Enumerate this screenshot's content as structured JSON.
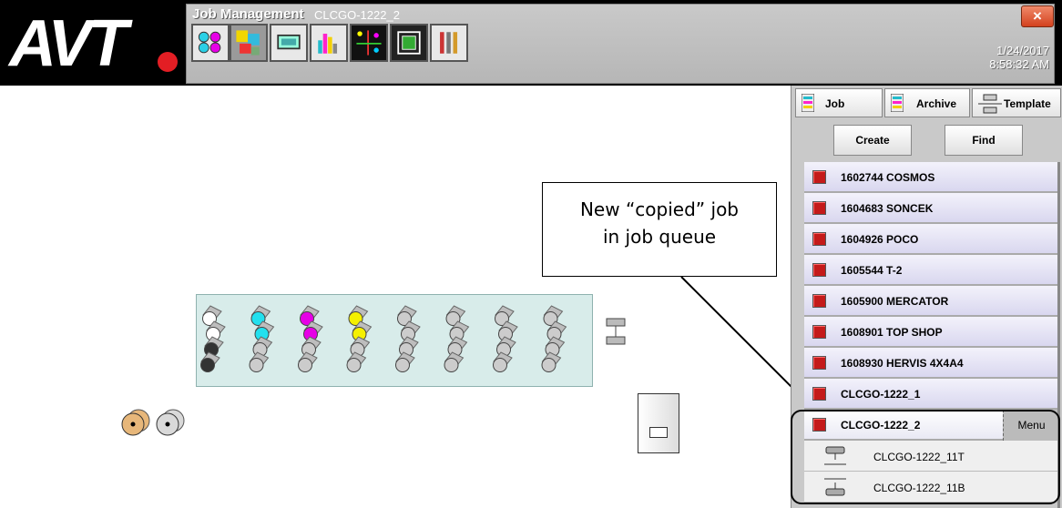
{
  "header": {
    "logo_text": "AVT",
    "app_title": "Job Management",
    "job_name": "CLCGO-1222_2",
    "date": "1/24/2017",
    "time": "8:58:32 AM",
    "close_label": "×",
    "toolbar": [
      "color-circles-icon",
      "job-management-icon",
      "monitor-icon",
      "bar-chart-icon",
      "registration-icon",
      "frame-icon",
      "tools-icon"
    ]
  },
  "panel": {
    "tabs": [
      {
        "label": "Job",
        "icon": "job-icon"
      },
      {
        "label": "Archive",
        "icon": "archive-icon"
      },
      {
        "label": "Template",
        "icon": "template-icon"
      }
    ],
    "create_label": "Create",
    "find_label": "Find",
    "jobs": [
      {
        "name": "1602744 COSMOS"
      },
      {
        "name": "1604683 SONCEK"
      },
      {
        "name": "1604926 POCO"
      },
      {
        "name": "1605544 T-2"
      },
      {
        "name": "1605900 MERCATOR"
      },
      {
        "name": "1608901 TOP SHOP"
      },
      {
        "name": "1608930 HERVIS 4X4A4"
      },
      {
        "name": "CLCGO-1222_1"
      }
    ],
    "selected_job": "CLCGO-1222_2",
    "menu_label": "Menu",
    "sub_items": [
      {
        "name": "CLCGO-1222_11T",
        "icon": "top-side-icon"
      },
      {
        "name": "CLCGO-1222_11B",
        "icon": "bottom-side-icon"
      }
    ]
  },
  "callout": {
    "line1": "New “copied” job",
    "line2": "in job queue"
  },
  "press": {
    "units": [
      {
        "colors": [
          "#ffffff",
          "#ffffff",
          "#333333",
          "#333333"
        ]
      },
      {
        "colors": [
          "#22e0ee",
          "#22e0ee",
          "#cccccc",
          "#cccccc"
        ]
      },
      {
        "colors": [
          "#e600e6",
          "#e600e6",
          "#cccccc",
          "#cccccc"
        ]
      },
      {
        "colors": [
          "#f5f000",
          "#f5f000",
          "#cccccc",
          "#cccccc"
        ]
      },
      {
        "colors": [
          "#cccccc",
          "#cccccc",
          "#cccccc",
          "#cccccc"
        ]
      },
      {
        "colors": [
          "#cccccc",
          "#cccccc",
          "#cccccc",
          "#cccccc"
        ]
      },
      {
        "colors": [
          "#cccccc",
          "#cccccc",
          "#cccccc",
          "#cccccc"
        ]
      },
      {
        "colors": [
          "#cccccc",
          "#cccccc",
          "#cccccc",
          "#cccccc"
        ]
      }
    ],
    "unwind_colors": [
      "#e7b77a",
      "#d9d9d9"
    ]
  }
}
